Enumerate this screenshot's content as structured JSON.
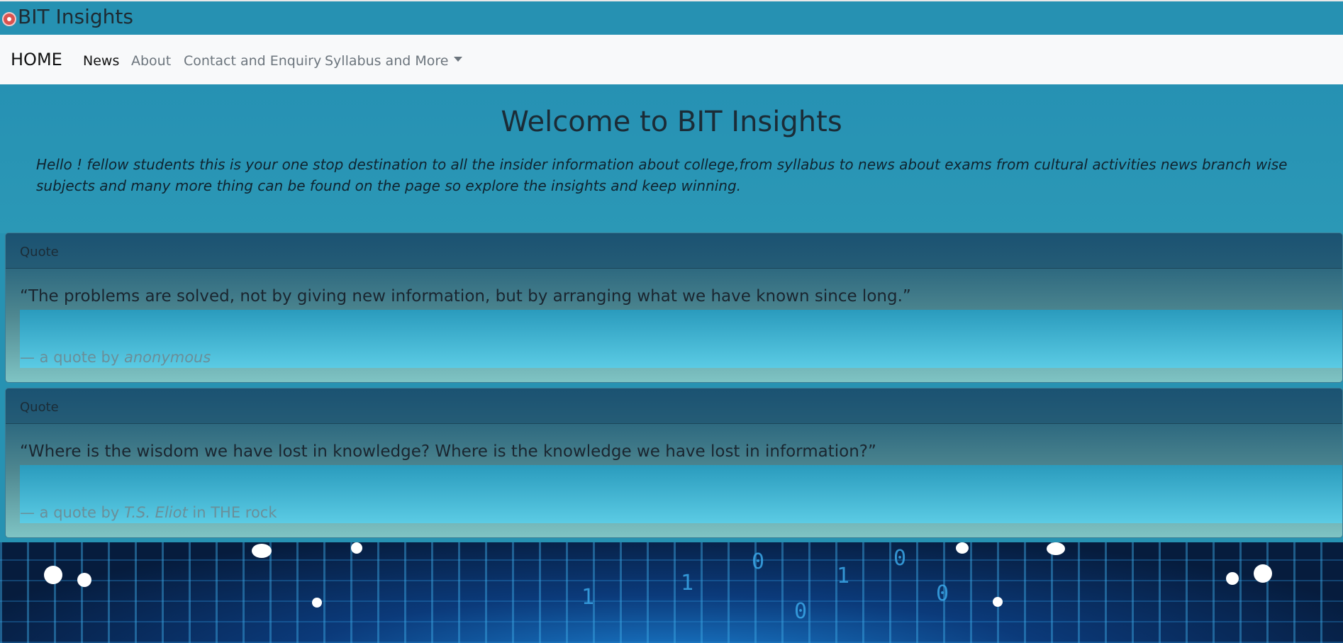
{
  "app": {
    "brand": "BIT Insights"
  },
  "nav": {
    "home": "HOME",
    "news": "News",
    "about": "About",
    "contact": "Contact and Enquiry",
    "syllabus": "Syllabus and More"
  },
  "hero": {
    "title": "Welcome to BIT Insights",
    "description": "Hello ! fellow students this is your one stop destination to all the insider information about college,from syllabus to news about exams from cultural activities news branch wise subjects and many more thing can be found on the page so explore the insights and keep winning."
  },
  "quotes": [
    {
      "header": "Quote",
      "text": "“The problems are solved, not by giving new information, but by arranging what we have known since long.”",
      "footer_prefix": "— a quote by",
      "author": "anonymous",
      "footer_suffix": ""
    },
    {
      "header": "Quote",
      "text": "“Where is the wisdom we have lost in knowledge? Where is the knowledge we have lost in information?”",
      "footer_prefix": "— a quote by",
      "author": "T.S. Eliot",
      "footer_suffix": "in THE rock"
    }
  ],
  "background": {
    "binary_glyphs": [
      "0",
      "1",
      "0",
      "1",
      "1",
      "0",
      "0"
    ]
  }
}
